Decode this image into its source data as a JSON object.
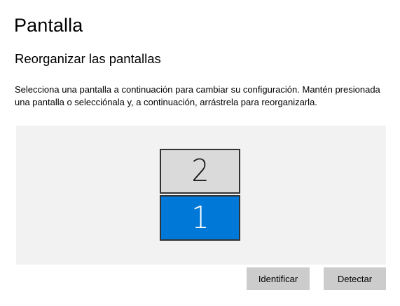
{
  "page": {
    "title": "Pantalla"
  },
  "arrange": {
    "section_title": "Reorganizar las pantallas",
    "description": "Selecciona una pantalla a continuación para cambiar su configuración. Mantén presionada una pantalla o selecciónala y, a continuación, arrástrela para reorganizarla.",
    "monitors": [
      {
        "number": "2",
        "selected": false
      },
      {
        "number": "1",
        "selected": true
      }
    ],
    "identify_label": "Identificar",
    "detect_label": "Detectar"
  },
  "colors": {
    "selected_monitor": "#0078d7",
    "unselected_monitor": "#dadada",
    "arrange_background": "#f2f2f2",
    "button_background": "#cccccc"
  }
}
